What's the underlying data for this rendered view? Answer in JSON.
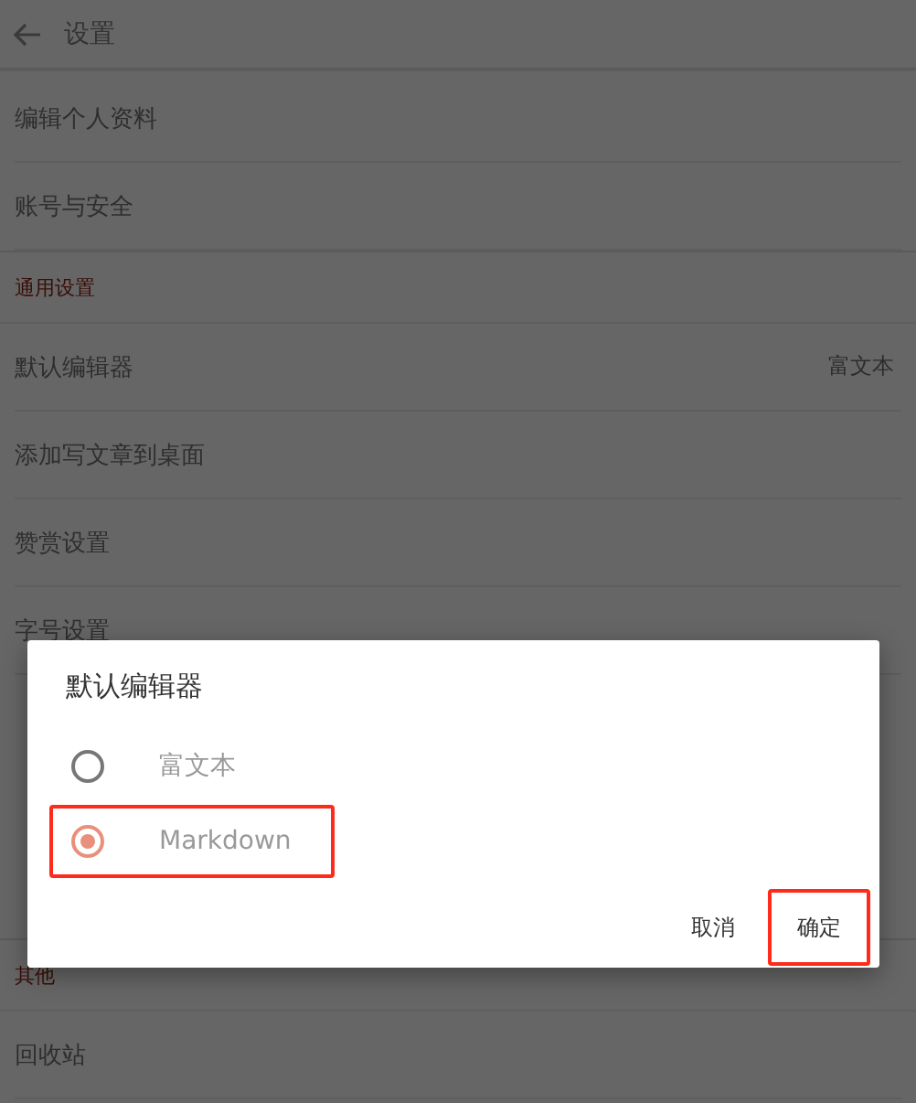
{
  "app_bar": {
    "title": "设置"
  },
  "sections": [
    {
      "items": [
        {
          "label": "编辑个人资料"
        },
        {
          "label": "账号与安全"
        }
      ]
    },
    {
      "header": "通用设置",
      "items": [
        {
          "label": "默认编辑器",
          "value": "富文本"
        },
        {
          "label": "添加写文章到桌面"
        },
        {
          "label": "赞赏设置"
        },
        {
          "label": "字号设置"
        }
      ]
    },
    {
      "header": "其他",
      "items": [
        {
          "label": "回收站"
        }
      ]
    }
  ],
  "dialog": {
    "title": "默认编辑器",
    "options": [
      {
        "label": "富文本",
        "selected": false,
        "highlighted": false
      },
      {
        "label": "Markdown",
        "selected": true,
        "highlighted": true
      }
    ],
    "buttons": [
      {
        "label": "取消",
        "highlighted": false
      },
      {
        "label": "确定",
        "highlighted": true
      }
    ]
  }
}
